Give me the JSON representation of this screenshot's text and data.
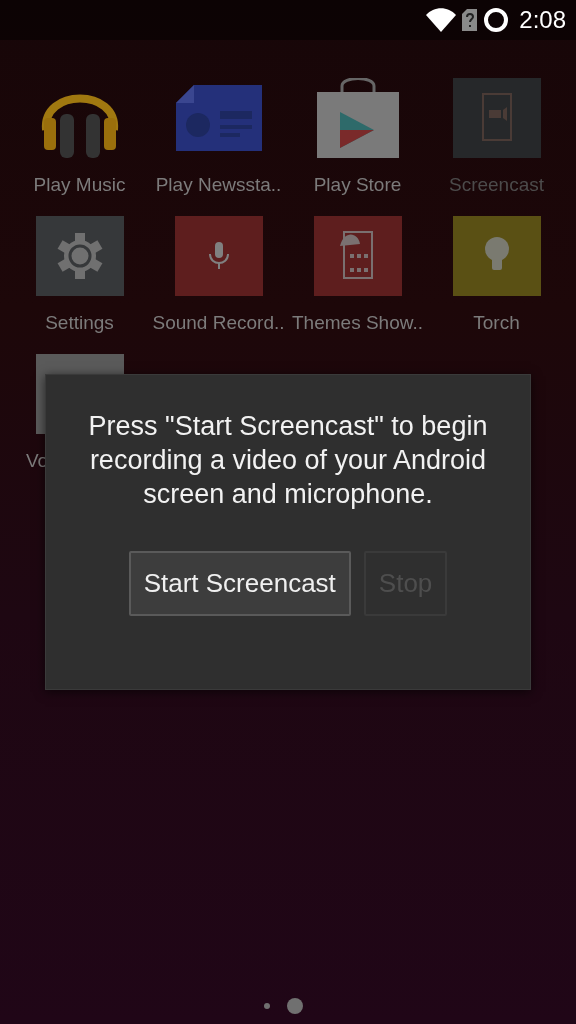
{
  "status_bar": {
    "time": "2:08"
  },
  "apps": [
    {
      "label": "Play Music",
      "kind": "app",
      "faded": false
    },
    {
      "label": "Play Newssta..",
      "kind": "app",
      "faded": false
    },
    {
      "label": "Play Store",
      "kind": "app",
      "faded": false
    },
    {
      "label": "Screencast",
      "kind": "app",
      "faded": true
    },
    {
      "label": "Settings",
      "kind": "app",
      "faded": false
    },
    {
      "label": "Sound Record..",
      "kind": "app",
      "faded": false
    },
    {
      "label": "Themes Show..",
      "kind": "app",
      "faded": false
    },
    {
      "label": "Torch",
      "kind": "app",
      "faded": false
    },
    {
      "label": "Vo",
      "kind": "partial",
      "faded": false
    }
  ],
  "dialog": {
    "message": "Press \"Start Screencast\" to begin recording a video of your Android screen and microphone.",
    "buttons": [
      {
        "label": "Start Screencast",
        "disabled": false
      },
      {
        "label": "Stop",
        "disabled": true
      }
    ]
  },
  "pages": [
    {
      "selected": false
    },
    {
      "selected": true
    }
  ]
}
